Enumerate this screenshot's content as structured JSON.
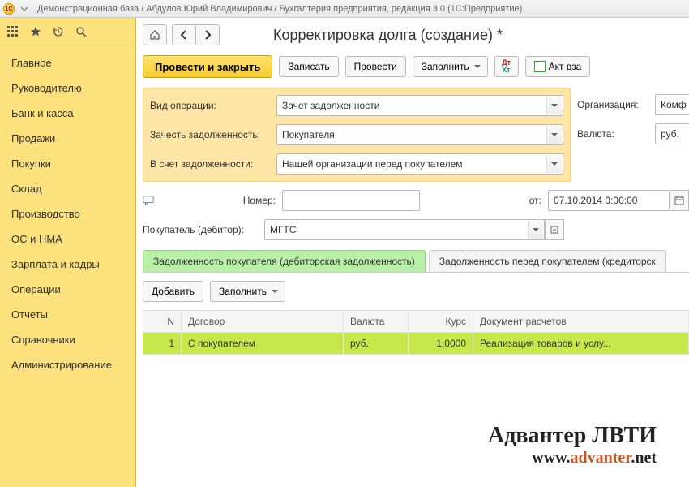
{
  "titlebar": "Демонстрационная база / Абдулов Юрий Владимирович / Бухгалтерия предприятия, редакция 3.0  (1С:Предприятие)",
  "sidebar": {
    "items": [
      {
        "label": "Главное"
      },
      {
        "label": "Руководителю"
      },
      {
        "label": "Банк и касса"
      },
      {
        "label": "Продажи"
      },
      {
        "label": "Покупки"
      },
      {
        "label": "Склад"
      },
      {
        "label": "Производство"
      },
      {
        "label": "ОС и НМА"
      },
      {
        "label": "Зарплата и кадры"
      },
      {
        "label": "Операции"
      },
      {
        "label": "Отчеты"
      },
      {
        "label": "Справочники"
      },
      {
        "label": "Администрирование"
      }
    ]
  },
  "page_title": "Корректировка долга (создание) *",
  "toolbar": {
    "primary": "Провести и закрыть",
    "save": "Записать",
    "post": "Провести",
    "fill": "Заполнить",
    "act": "Акт вза"
  },
  "form": {
    "op_type_label": "Вид операции:",
    "op_type_value": "Зачет задолженности",
    "credit_label": "Зачесть задолженность:",
    "credit_value": "Покупателя",
    "against_label": "В счет задолженности:",
    "against_value": "Нашей организации перед покупателем",
    "org_label": "Организация:",
    "org_value": "Комф",
    "currency_label": "Валюта:",
    "currency_value": "руб.",
    "number_label": "Номер:",
    "number_value": "",
    "from_label": "от:",
    "date_value": "07.10.2014  0:00:00",
    "buyer_label": "Покупатель (дебитор):",
    "buyer_value": "МГТС"
  },
  "tabs": [
    {
      "label": "Задолженность покупателя (дебиторская задолженность)"
    },
    {
      "label": "Задолженность перед покупателем (кредиторск"
    }
  ],
  "tab_toolbar": {
    "add": "Добавить",
    "fill": "Заполнить"
  },
  "table": {
    "columns": [
      "N",
      "Договор",
      "Валюта",
      "Курс",
      "Документ расчетов"
    ],
    "rows": [
      {
        "n": "1",
        "contract": "С покупателем",
        "currency": "руб.",
        "rate": "1,0000",
        "doc": "Реализация товаров и услу..."
      }
    ]
  },
  "watermark": {
    "line1": "Адвантер ЛВТИ",
    "line2_a": "www.",
    "line2_b": "advanter",
    "line2_c": ".net"
  }
}
